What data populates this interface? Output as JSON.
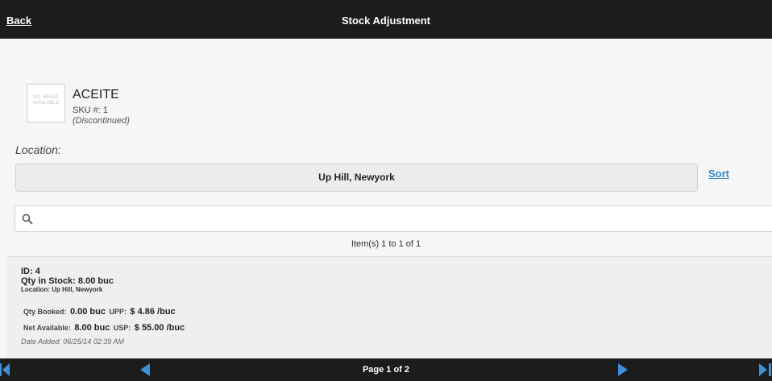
{
  "header": {
    "back_label": "Back",
    "title": "Stock Adjustment"
  },
  "product": {
    "image_placeholder": "NO IMAGE AVAILABLE",
    "name": "ACEITE",
    "sku": "SKU #: 1",
    "status": "(Discontinued)"
  },
  "location": {
    "label": "Location:",
    "selected": "Up Hill, Newyork",
    "sort_label": "Sort"
  },
  "search": {
    "value": "",
    "placeholder": ""
  },
  "list": {
    "count_text": "Item(s) 1 to 1 of 1",
    "items": [
      {
        "id": "ID: 4",
        "qty_in_stock": "Qty in Stock: 8.00 buc",
        "location": "Location: Up Hill, Newyork",
        "qty_booked_label": "Qty Booked:",
        "qty_booked_value": "0.00 buc",
        "upp_label": "UPP:",
        "upp_value": "$ 4.86 /buc",
        "net_available_label": "Net Available:",
        "net_available_value": "8.00 buc",
        "usp_label": "USP:",
        "usp_value": "$ 55.00 /buc",
        "date_added": "Date Added: 06/25/14 02:39 AM"
      }
    ]
  },
  "footer": {
    "page_text": "Page 1 of 2",
    "nav_color": "#3f8fd8"
  },
  "colors": {
    "bar_background": "#1c1c1c",
    "link_blue": "#3388cc"
  }
}
